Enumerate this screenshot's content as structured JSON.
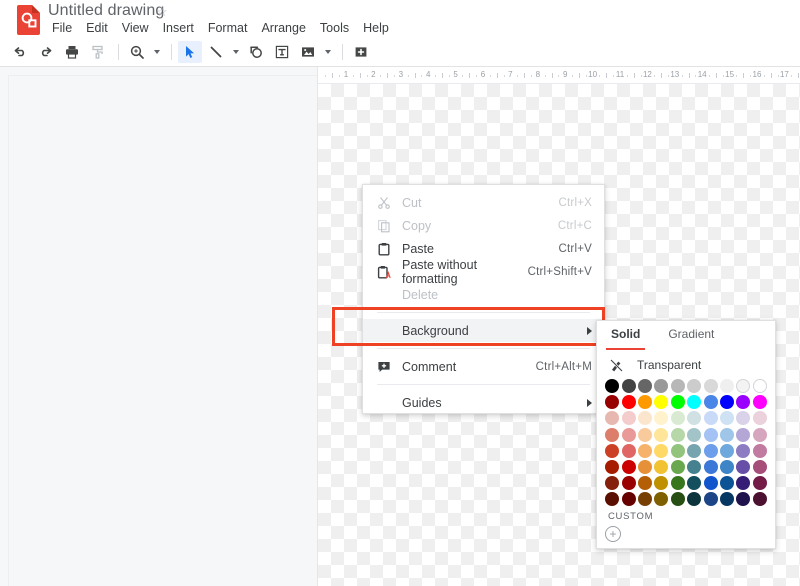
{
  "app": {
    "logo_icon": "google-drawings-logo",
    "doc_title": "Untitled drawing",
    "star_icon": "star-outline-icon"
  },
  "menubar": {
    "items": [
      {
        "label": "File"
      },
      {
        "label": "Edit"
      },
      {
        "label": "View"
      },
      {
        "label": "Insert"
      },
      {
        "label": "Format"
      },
      {
        "label": "Arrange"
      },
      {
        "label": "Tools"
      },
      {
        "label": "Help"
      }
    ]
  },
  "toolbar": {
    "items": [
      {
        "name": "undo-button",
        "icon": "undo-icon",
        "type": "button",
        "active": false
      },
      {
        "name": "redo-button",
        "icon": "redo-icon",
        "type": "button",
        "active": false
      },
      {
        "name": "print-button",
        "icon": "print-icon",
        "type": "button",
        "active": false
      },
      {
        "name": "paint-format-button",
        "icon": "paint-format-icon",
        "type": "button",
        "active": false
      },
      {
        "name": "separator-1",
        "icon": "separator",
        "type": "separator",
        "active": false
      },
      {
        "name": "zoom-button",
        "icon": "magnifier-icon",
        "type": "button",
        "active": false
      },
      {
        "name": "zoom-dropdown",
        "icon": "chevron-down-icon",
        "type": "caret",
        "active": false
      },
      {
        "name": "separator-2",
        "icon": "separator",
        "type": "separator",
        "active": false
      },
      {
        "name": "select-tool-button",
        "icon": "cursor-arrow-icon",
        "type": "button",
        "active": true
      },
      {
        "name": "line-tool-button",
        "icon": "line-icon",
        "type": "button",
        "active": false
      },
      {
        "name": "line-tool-dropdown",
        "icon": "chevron-down-icon",
        "type": "caret",
        "active": false
      },
      {
        "name": "shape-tool-button",
        "icon": "shape-icon",
        "type": "button",
        "active": false
      },
      {
        "name": "text-box-button",
        "icon": "text-box-icon",
        "type": "button",
        "active": false
      },
      {
        "name": "image-button",
        "icon": "image-icon",
        "type": "button",
        "active": false
      },
      {
        "name": "image-dropdown",
        "icon": "chevron-down-icon",
        "type": "caret",
        "active": false
      },
      {
        "name": "separator-3",
        "icon": "separator",
        "type": "separator",
        "active": false
      },
      {
        "name": "resize-canvas-button",
        "icon": "resize-plus-icon",
        "type": "button",
        "active": false
      }
    ]
  },
  "ruler": {
    "labels": [
      "1",
      "2",
      "3",
      "4",
      "5",
      "6",
      "7",
      "8",
      "9",
      "10",
      "11",
      "12",
      "13",
      "14",
      "15",
      "16",
      "17"
    ],
    "unit": "inch"
  },
  "canvas": {
    "background": "transparent-checkerboard"
  },
  "context_menu": {
    "rows": [
      {
        "type": "item",
        "name": "menu-item-cut",
        "icon": "scissors-icon",
        "label": "Cut",
        "shortcut": "Ctrl+X",
        "disabled": true,
        "highlight": false,
        "submenu": false
      },
      {
        "type": "item",
        "name": "menu-item-copy",
        "icon": "copy-icon",
        "label": "Copy",
        "shortcut": "Ctrl+C",
        "disabled": true,
        "highlight": false,
        "submenu": false
      },
      {
        "type": "item",
        "name": "menu-item-paste",
        "icon": "clipboard-icon",
        "label": "Paste",
        "shortcut": "Ctrl+V",
        "disabled": false,
        "highlight": false,
        "submenu": false
      },
      {
        "type": "item",
        "name": "menu-item-paste-without-formatting",
        "icon": "clipboard-a-icon",
        "label": "Paste without formatting",
        "shortcut": "Ctrl+Shift+V",
        "disabled": false,
        "highlight": false,
        "submenu": false
      },
      {
        "type": "item",
        "name": "menu-item-delete",
        "icon": "none",
        "label": "Delete",
        "shortcut": "",
        "disabled": true,
        "highlight": false,
        "submenu": false
      },
      {
        "type": "separator",
        "name": "menu-separator-1"
      },
      {
        "type": "item",
        "name": "menu-item-background",
        "icon": "none",
        "label": "Background",
        "shortcut": "",
        "disabled": false,
        "highlight": true,
        "submenu": true
      },
      {
        "type": "separator",
        "name": "menu-separator-2"
      },
      {
        "type": "item",
        "name": "menu-item-comment",
        "icon": "comment-plus-icon",
        "label": "Comment",
        "shortcut": "Ctrl+Alt+M",
        "disabled": false,
        "highlight": false,
        "submenu": false
      },
      {
        "type": "separator",
        "name": "menu-separator-3"
      },
      {
        "type": "item",
        "name": "menu-item-guides",
        "icon": "none",
        "label": "Guides",
        "shortcut": "",
        "disabled": false,
        "highlight": false,
        "submenu": true
      }
    ]
  },
  "annotation": {
    "highlight_box_color": "#ef4123",
    "target": "Background"
  },
  "color_picker": {
    "tabs": [
      {
        "name": "tab-solid",
        "label": "Solid",
        "selected": true
      },
      {
        "name": "tab-gradient",
        "label": "Gradient",
        "selected": false
      }
    ],
    "transparent_label": "Transparent",
    "transparent_icon": "no-fill-icon",
    "custom_label": "CUSTOM",
    "add_custom_icon": "plus-circle-icon",
    "accent_color": "#ea4335",
    "swatch_rows": [
      [
        "#000000",
        "#434343",
        "#666666",
        "#999999",
        "#b7b7b7",
        "#cccccc",
        "#d9d9d9",
        "#efefef",
        "#f3f3f3",
        "#ffffff"
      ],
      [
        "#980000",
        "#ff0000",
        "#ff9900",
        "#ffff00",
        "#00ff00",
        "#00ffff",
        "#4a86e8",
        "#0000ff",
        "#9900ff",
        "#ff00ff"
      ],
      [
        "#e6b8af",
        "#f4cccc",
        "#fce5cd",
        "#fff2cc",
        "#d9ead3",
        "#d0e0e3",
        "#c9daf8",
        "#cfe2f3",
        "#d9d2e9",
        "#ead1dc"
      ],
      [
        "#dd7e6b",
        "#ea9999",
        "#f9cb9c",
        "#ffe599",
        "#b6d7a8",
        "#a2c4c9",
        "#a4c2f4",
        "#9fc5e8",
        "#b4a7d6",
        "#d5a6bd"
      ],
      [
        "#cc4125",
        "#e06666",
        "#f6b26b",
        "#ffd966",
        "#93c47d",
        "#76a5af",
        "#6d9eeb",
        "#6fa8dc",
        "#8e7cc3",
        "#c27ba0"
      ],
      [
        "#a61c00",
        "#cc0000",
        "#e69138",
        "#f1c232",
        "#6aa84f",
        "#45818e",
        "#3c78d8",
        "#3d85c6",
        "#674ea7",
        "#a64d79"
      ],
      [
        "#85200c",
        "#990000",
        "#b45f06",
        "#bf9000",
        "#38761d",
        "#134f5c",
        "#1155cc",
        "#0b5394",
        "#351c75",
        "#741b47"
      ],
      [
        "#5b0f00",
        "#660000",
        "#783f04",
        "#7f6000",
        "#274e13",
        "#0c343d",
        "#1c4587",
        "#073763",
        "#20124d",
        "#4c1130"
      ]
    ]
  }
}
